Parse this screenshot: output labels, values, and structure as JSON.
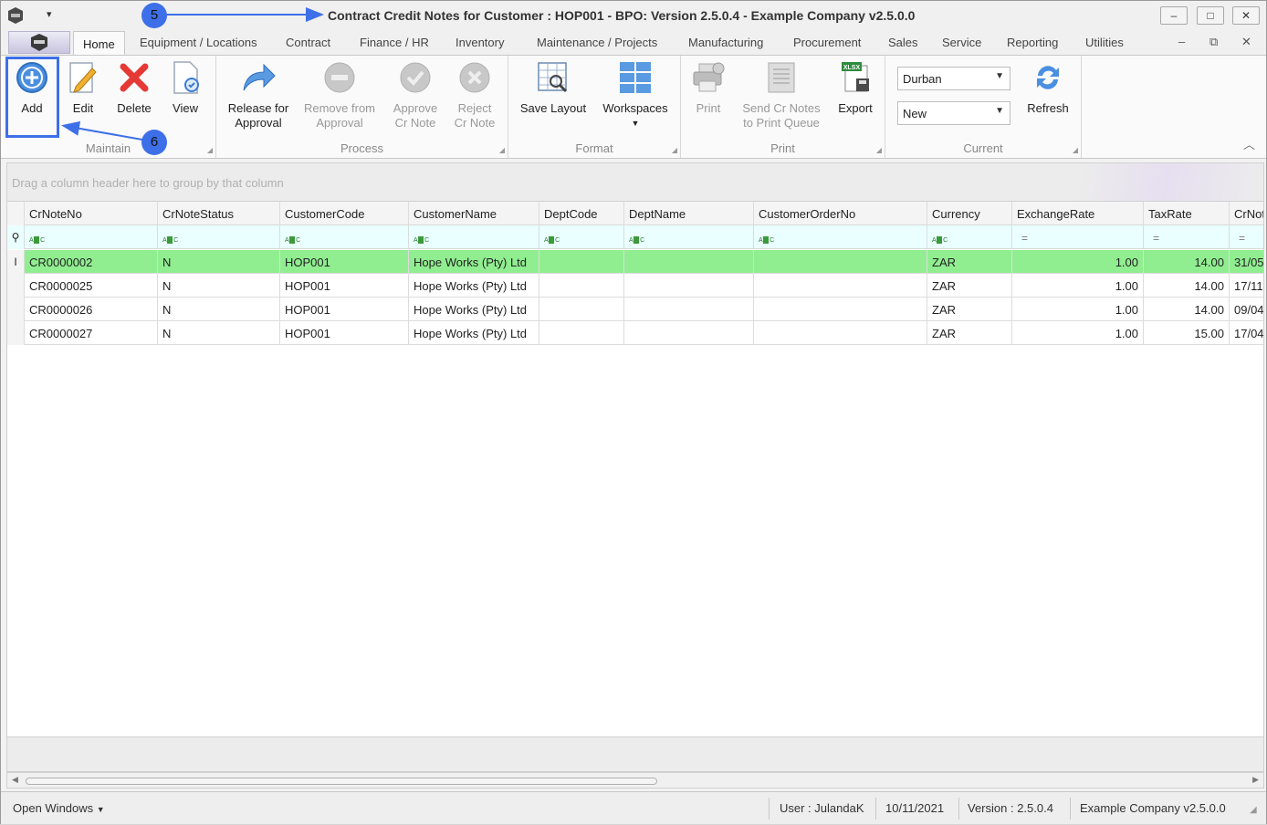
{
  "window": {
    "title_prefix": "Contract Credit Notes for Customer : HOP001",
    "title_rest": " - BPO: Version 2.5.0.4 - Example Company v2.5.0.0",
    "minimize": "–",
    "maximize": "□",
    "close": "✕"
  },
  "tabs": [
    "Home",
    "Equipment / Locations",
    "Contract",
    "Finance / HR",
    "Inventory",
    "Maintenance / Projects",
    "Manufacturing",
    "Procurement",
    "Sales",
    "Service",
    "Reporting",
    "Utilities"
  ],
  "ribbon": {
    "maintain": {
      "label": "Maintain",
      "add": "Add",
      "edit": "Edit",
      "delete": "Delete",
      "view": "View"
    },
    "process": {
      "label": "Process",
      "release_1": "Release for",
      "release_2": "Approval",
      "remove_1": "Remove from",
      "remove_2": "Approval",
      "approve_1": "Approve",
      "approve_2": "Cr Note",
      "reject_1": "Reject",
      "reject_2": "Cr Note"
    },
    "format": {
      "label": "Format",
      "save_layout": "Save Layout",
      "workspaces": "Workspaces"
    },
    "print": {
      "label": "Print",
      "print": "Print",
      "send_1": "Send Cr Notes",
      "send_2": "to Print Queue",
      "export": "Export",
      "export_badge": "XLSX"
    },
    "current": {
      "label": "Current",
      "site": "Durban",
      "status": "New",
      "refresh": "Refresh"
    }
  },
  "grid": {
    "group_hint": "Drag a column header here to group by that column",
    "columns": [
      "CrNoteNo",
      "CrNoteStatus",
      "CustomerCode",
      "CustomerName",
      "DeptCode",
      "DeptName",
      "CustomerOrderNo",
      "Currency",
      "ExchangeRate",
      "TaxRate",
      "CrNot"
    ],
    "filter_eq": "=",
    "rows": [
      [
        "CR0000002",
        "N",
        "HOP001",
        "Hope Works (Pty) Ltd",
        "",
        "",
        "",
        "ZAR",
        "1.00",
        "14.00",
        "31/05"
      ],
      [
        "CR0000025",
        "N",
        "HOP001",
        "Hope Works (Pty) Ltd",
        "",
        "",
        "",
        "ZAR",
        "1.00",
        "14.00",
        "17/11"
      ],
      [
        "CR0000026",
        "N",
        "HOP001",
        "Hope Works (Pty) Ltd",
        "",
        "",
        "",
        "ZAR",
        "1.00",
        "14.00",
        "09/04"
      ],
      [
        "CR0000027",
        "N",
        "HOP001",
        "Hope Works (Pty) Ltd",
        "",
        "",
        "",
        "ZAR",
        "1.00",
        "15.00",
        "17/04"
      ]
    ],
    "selected_row": 0
  },
  "status": {
    "open_windows": "Open Windows",
    "user": "User : JulandaK",
    "date": "10/11/2021",
    "version": "Version : 2.5.0.4",
    "company": "Example Company v2.5.0.0"
  },
  "annotations": {
    "step5": "5",
    "step6": "6",
    "accent": "#3d6fe8"
  },
  "colors": {
    "selected_row": "#90ee90",
    "filter_row": "#eaffff",
    "delete_red": "#e53935"
  }
}
